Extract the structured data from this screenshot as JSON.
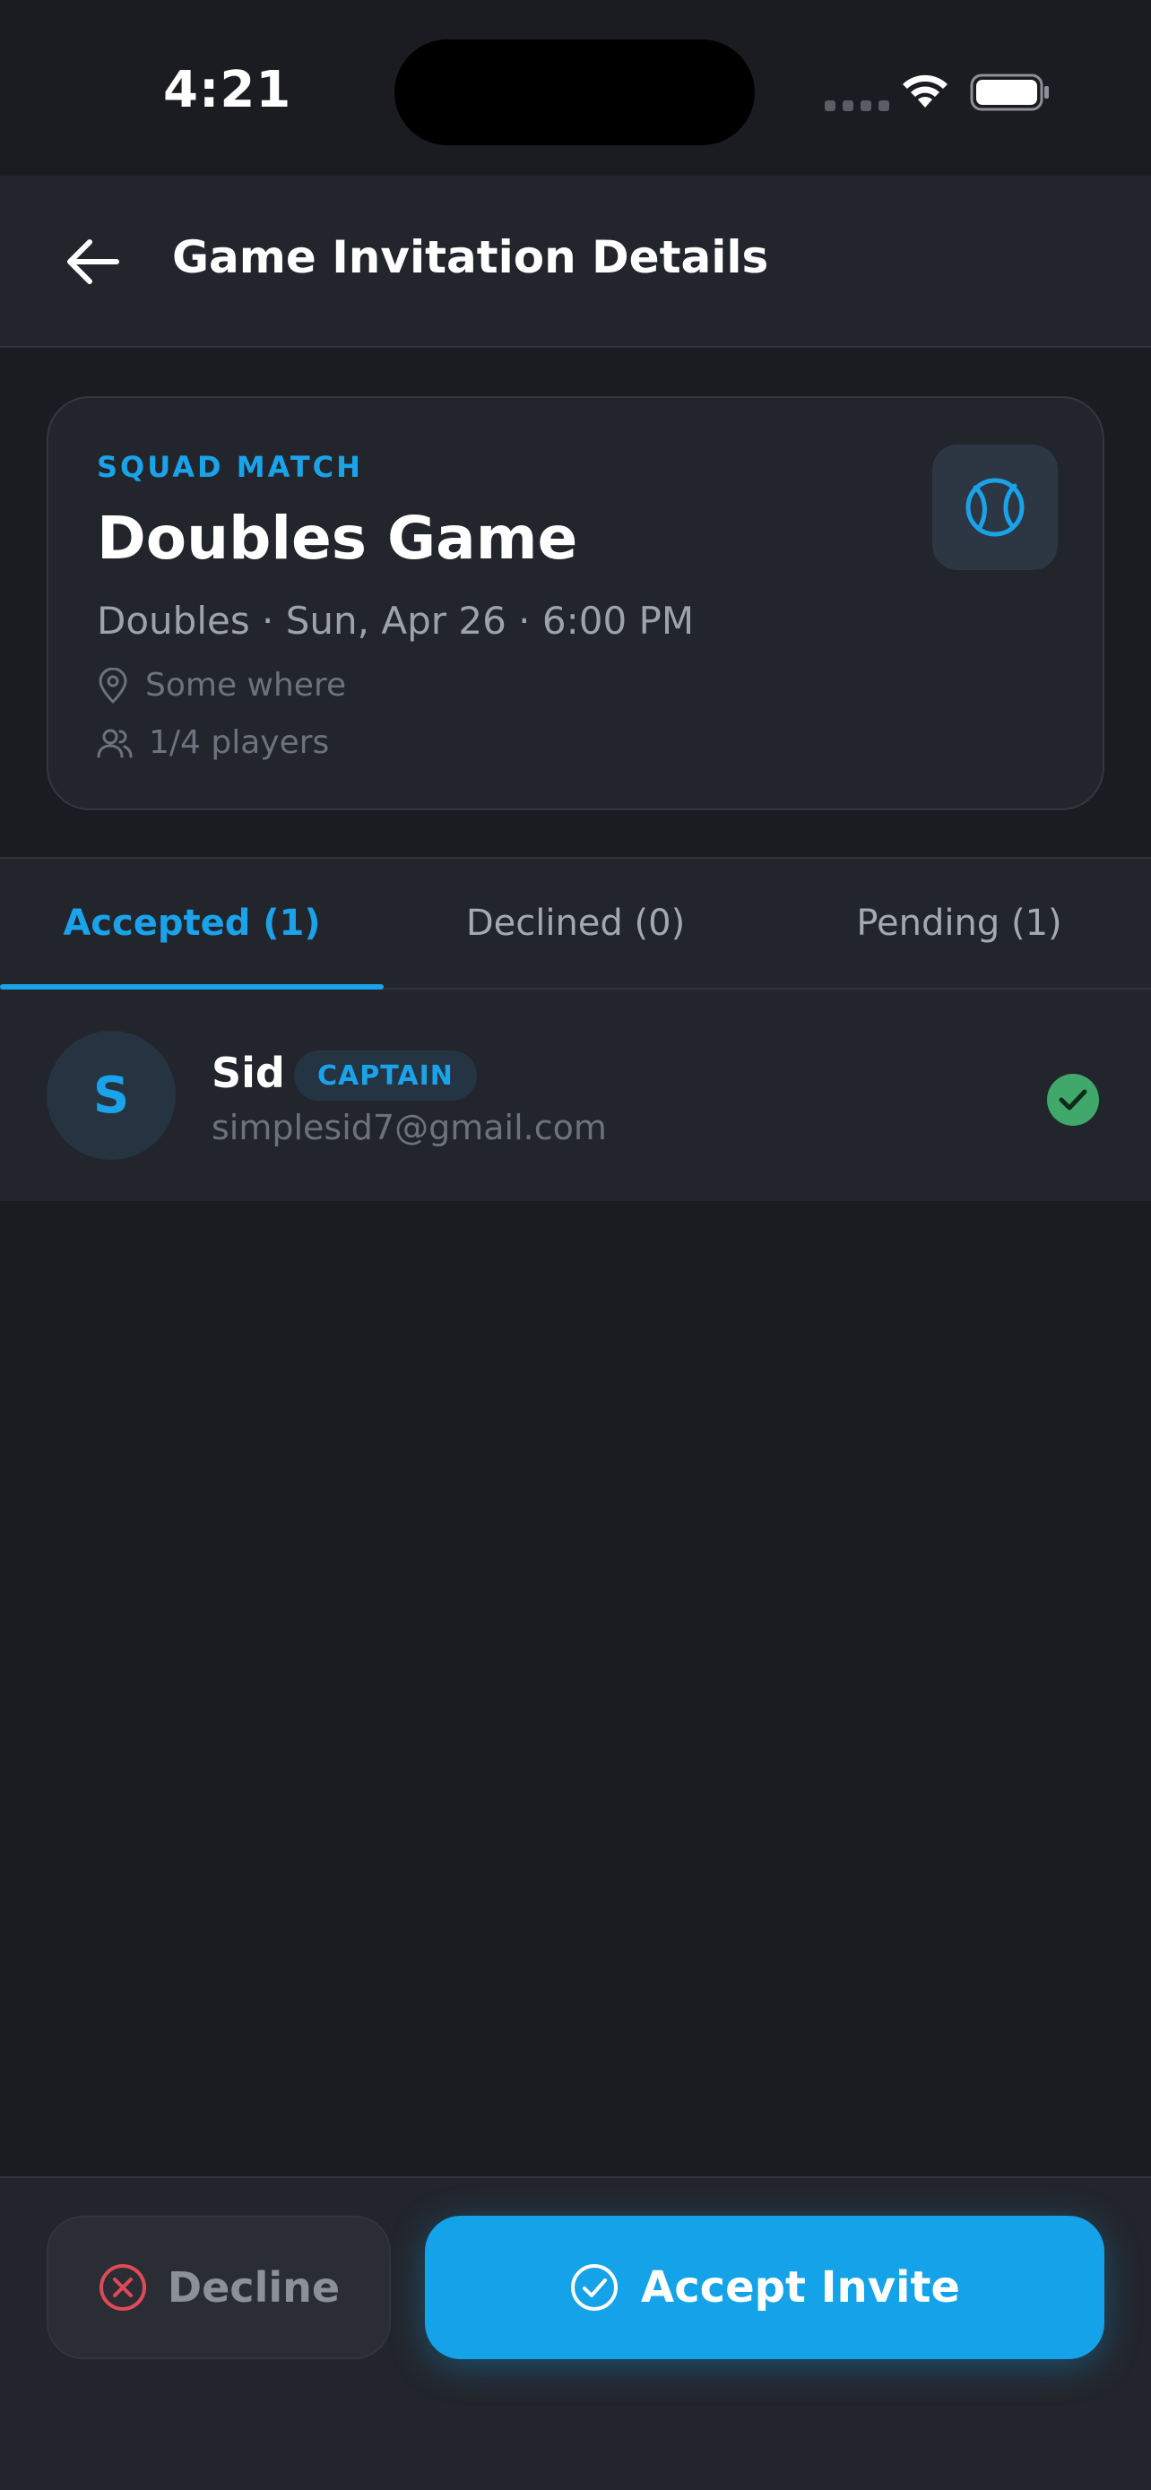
{
  "status_bar": {
    "time": "4:21"
  },
  "header": {
    "title": "Game Invitation Details"
  },
  "game": {
    "match_type": "SQUAD MATCH",
    "title": "Doubles Game",
    "meta": "Doubles · Sun, Apr 26 · 6:00 PM",
    "location": "Some where",
    "players": "1/4 players",
    "sport_icon": "tennis-ball-icon"
  },
  "tabs": [
    {
      "label": "Accepted (1)",
      "active": true
    },
    {
      "label": "Declined (0)",
      "active": false
    },
    {
      "label": "Pending (1)",
      "active": false
    }
  ],
  "members": [
    {
      "initial": "S",
      "name": "Sid",
      "role_badge": "CAPTAIN",
      "email": "simplesid7@gmail.com",
      "status": "accepted"
    }
  ],
  "actions": {
    "decline_label": "Decline",
    "accept_label": "Accept Invite"
  },
  "colors": {
    "accent": "#1aa3ea",
    "success": "#3fa86a",
    "danger": "#e04a57",
    "background": "#1b1c21",
    "surface": "#23252c"
  }
}
